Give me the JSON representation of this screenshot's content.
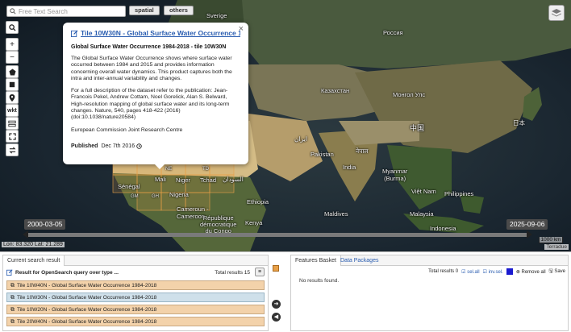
{
  "search": {
    "placeholder": "Free Text Search"
  },
  "top_buttons": {
    "spatial": "spatial",
    "others": "others"
  },
  "toolbar": {
    "wkt_label": "wkt"
  },
  "map_labels": {
    "sverige": "Sverige",
    "russia": "Россия",
    "kazakhstan": "Казахстан",
    "mongolia": "Монгол Улс",
    "china": "中国",
    "japan": "日本",
    "iran": "ایران",
    "pakistan": "Pakistan",
    "nepal": "नेपाल",
    "india": "India",
    "myanmar": "Myanmar\n(Burma)",
    "vietnam": "Việt Nam",
    "philippines": "Philippines",
    "malaysia": "Malaysia",
    "indonesia": "Indonesia",
    "maldives": "Maldives",
    "ethiopia": "Ethiopia",
    "kenya": "Kenya",
    "mali": "Mali",
    "niger": "Niger",
    "chad": "Tchad",
    "sudan": "السودان",
    "senegal": "Sénégal",
    "nigeria": "Nigeria",
    "cameroun": "Cameroun -\nCameroon",
    "rdc": "République\ndémocratique\ndu Congo",
    "tile_gh": "GH",
    "tile_ne": "NE",
    "tile_td": "TD",
    "tile_gm": "GM"
  },
  "popup": {
    "title": "Tile 10W30N - Global Surface Water Occurrence 1984-2018",
    "subtitle": "Global Surface Water Occurrence 1984-2018 - tile 10W30N",
    "para1": "The Global Surface Water Occurrence shows where surface water occurred between 1984 and 2015 and provides information concerning overall water dynamics. This product captures both the intra and inter-annual variability and changes.",
    "para2": "For a full description of the dataset refer to the publication: Jean-Francois Pekel, Andrew Cottam, Noel Gorelick, Alan S. Belward, High-resolution mapping of global surface water and its long-term changes. Nature, 540, pages 418-422 (2016) (doi:10.1038/nature20584)",
    "para3": "European Commission Joint Research Centre",
    "published_label": "Published",
    "published_date": "Dec 7th 2016"
  },
  "timeline": {
    "start": "2000-03-05",
    "end": "2025-09-06"
  },
  "map_footer": {
    "coords": "Lon: 83.320 Lat: 21.289",
    "scale": "1000 km",
    "attribution": "Terradue"
  },
  "left_panel": {
    "tab": "Current search result",
    "query": "Result for OpenSearch query over type ...",
    "total_label": "Total results",
    "total_value": "15",
    "rows": [
      "Tile 10W40N - Global Surface Water Occurrence 1984-2018",
      "Tile 10W30N - Global Surface Water Occurrence 1984-2018",
      "Tile 10W20N - Global Surface Water Occurrence 1984-2018",
      "Tile 20W40N - Global Surface Water Occurrence 1984-2018"
    ]
  },
  "right_panel": {
    "tab_features": "Features Basket",
    "tab_datapackages": "Data Packages",
    "total_label": "Total results",
    "total_value": "0",
    "sel_all": "sel.all",
    "inv_sel": "inv.sel.",
    "remove_all": "Remove all",
    "save": "Save",
    "no_results": "No results found."
  },
  "colors": {
    "result_row": "#f3d2aa",
    "result_row_selected": "#cfe0ea",
    "link": "#2a5db0",
    "basket_orange": "#e8a048",
    "basket_blue": "#1a1ad0"
  }
}
